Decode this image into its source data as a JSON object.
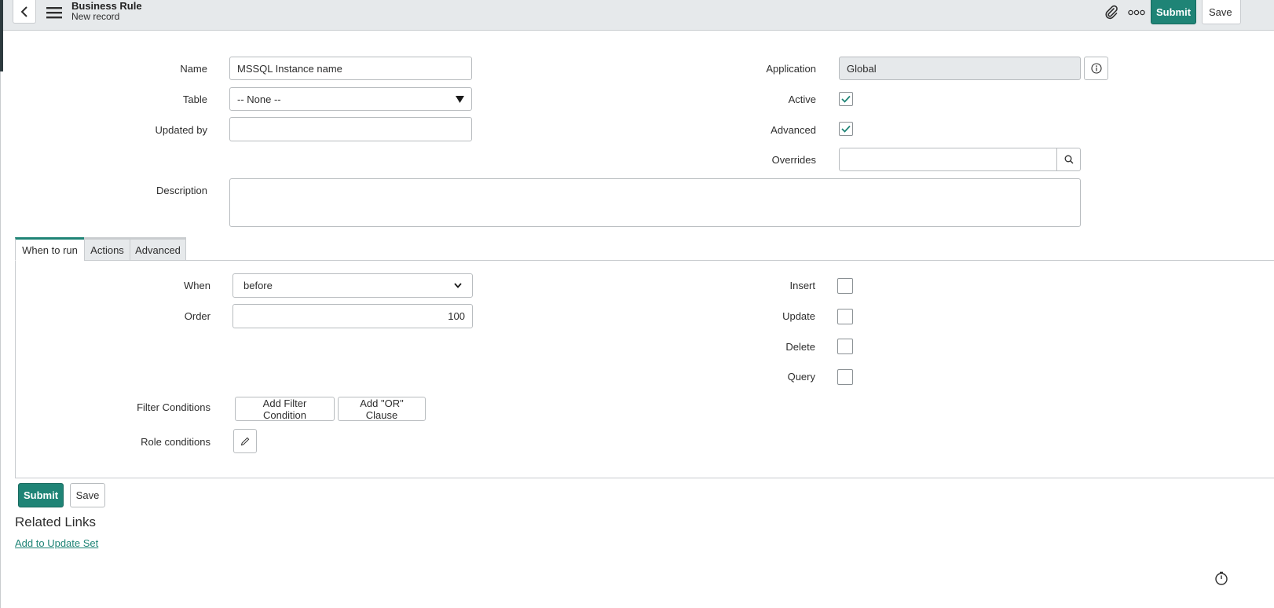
{
  "header": {
    "title": "Business Rule",
    "subtitle": "New record",
    "submit_label": "Submit",
    "save_label": "Save",
    "icons": [
      "back-chevron-icon",
      "hamburger-menu-icon",
      "paperclip-icon",
      "more-options-icon"
    ]
  },
  "form": {
    "name": {
      "label": "Name",
      "value": "MSSQL Instance name"
    },
    "table": {
      "label": "Table",
      "value": "-- None --"
    },
    "updated_by": {
      "label": "Updated by",
      "value": ""
    },
    "description": {
      "label": "Description",
      "value": ""
    },
    "application": {
      "label": "Application",
      "value": "Global"
    },
    "active": {
      "label": "Active",
      "checked": true
    },
    "advanced": {
      "label": "Advanced",
      "checked": true
    },
    "overrides": {
      "label": "Overrides",
      "value": ""
    }
  },
  "tabs": [
    {
      "label": "When to run",
      "active": true
    },
    {
      "label": "Actions",
      "active": false
    },
    {
      "label": "Advanced",
      "active": false
    }
  ],
  "when_to_run": {
    "when": {
      "label": "When",
      "value": "before"
    },
    "order": {
      "label": "Order",
      "value": "100"
    },
    "insert": {
      "label": "Insert",
      "checked": false
    },
    "update": {
      "label": "Update",
      "checked": false
    },
    "delete": {
      "label": "Delete",
      "checked": false
    },
    "query": {
      "label": "Query",
      "checked": false
    },
    "filter_conditions": {
      "label": "Filter Conditions",
      "add_filter_label": "Add Filter Condition",
      "add_or_label": "Add \"OR\" Clause"
    },
    "role_conditions": {
      "label": "Role conditions"
    }
  },
  "footer": {
    "submit_label": "Submit",
    "save_label": "Save",
    "related_links_title": "Related Links",
    "related_links": [
      {
        "label": "Add to Update Set"
      }
    ]
  },
  "colors": {
    "accent": "#1f8476",
    "header_bg": "#e6e9eb",
    "border": "#b8bcbf"
  }
}
